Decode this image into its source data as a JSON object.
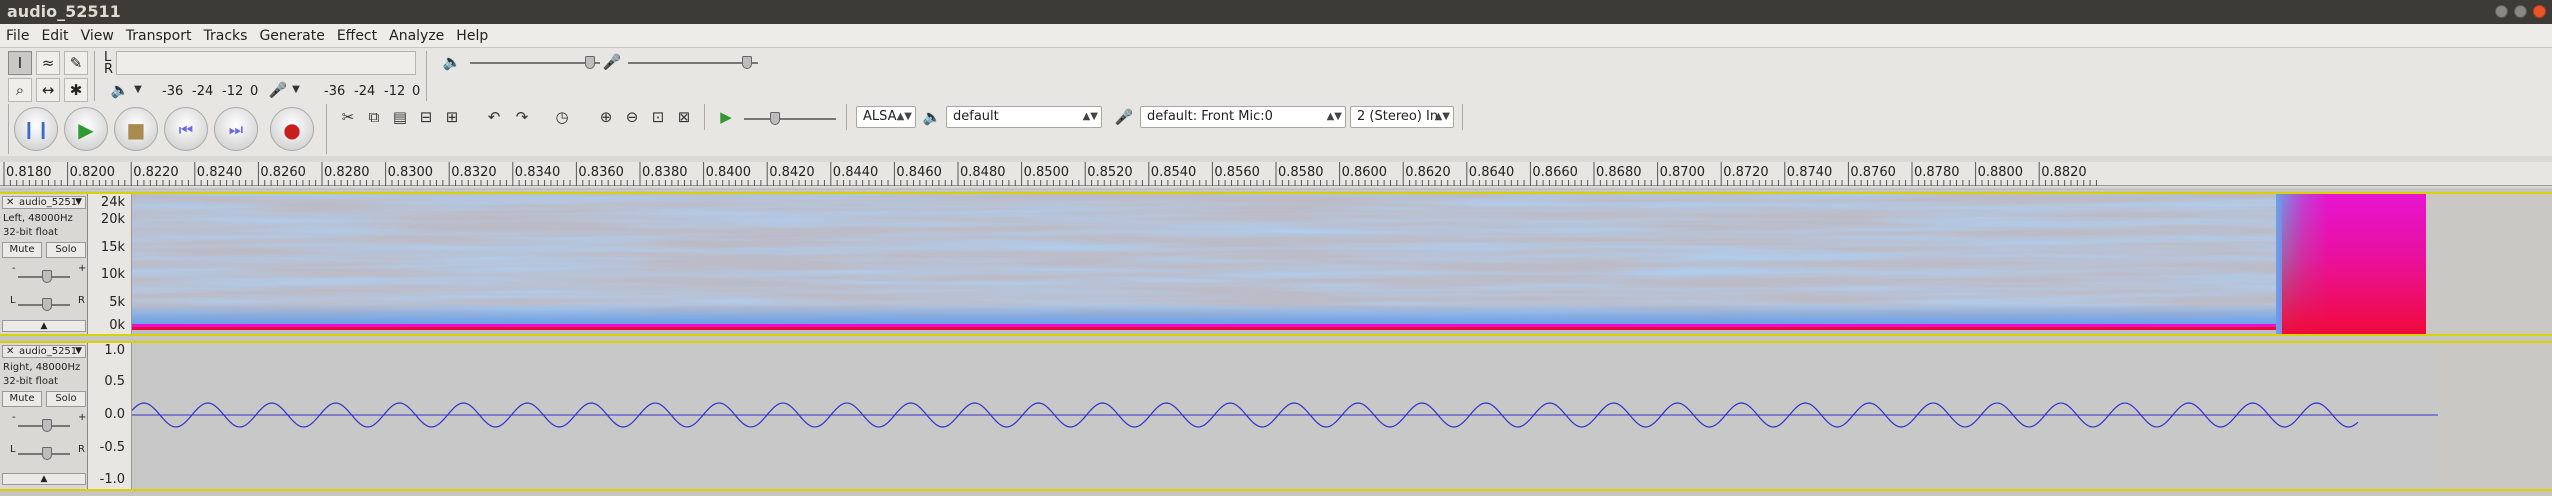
{
  "window": {
    "title": "audio_52511"
  },
  "menu": [
    "File",
    "Edit",
    "View",
    "Transport",
    "Tracks",
    "Generate",
    "Effect",
    "Analyze",
    "Help"
  ],
  "meters": {
    "lr_top": "L",
    "lr_bottom": "R",
    "rec_scale": [
      "-36",
      "-24",
      "-12",
      "0"
    ],
    "play_scale": [
      "-36",
      "-24",
      "-12",
      "0"
    ]
  },
  "device": {
    "host": "ALSA",
    "playback": "default",
    "recording": "default: Front Mic:0",
    "channels": "2 (Stereo) In"
  },
  "ruler": {
    "labels": [
      "0.8180",
      "0.8200",
      "0.8220",
      "0.8240",
      "0.8260",
      "0.8280",
      "0.8300",
      "0.8320",
      "0.8340",
      "0.8360",
      "0.8380",
      "0.8400",
      "0.8420",
      "0.8440",
      "0.8460",
      "0.8480",
      "0.8500",
      "0.8520",
      "0.8540",
      "0.8560",
      "0.8580",
      "0.8600",
      "0.8620",
      "0.8640",
      "0.8660",
      "0.8680",
      "0.8700",
      "0.8720",
      "0.8740",
      "0.8760",
      "0.8780",
      "0.8800",
      "0.8820"
    ]
  },
  "tracks": [
    {
      "name": "audio_5251",
      "channel_info": "Left, 48000Hz",
      "format": "32-bit float",
      "mute_label": "Mute",
      "solo_label": "Solo",
      "gain_minus": "-",
      "gain_plus": "+",
      "pan_left": "L",
      "pan_right": "R",
      "view": "spectrogram",
      "scale": [
        "24k",
        "20k",
        "15k",
        "10k",
        "5k",
        "0k"
      ]
    },
    {
      "name": "audio_5251",
      "channel_info": "Right, 48000Hz",
      "format": "32-bit float",
      "mute_label": "Mute",
      "solo_label": "Solo",
      "gain_minus": "-",
      "gain_plus": "+",
      "pan_left": "L",
      "pan_right": "R",
      "view": "waveform",
      "scale": [
        "1.0",
        "0.5",
        "0.0",
        "-0.5",
        "-1.0"
      ]
    }
  ],
  "colors": {
    "waveform": "#3232c8",
    "spectro_bg": "#bcbcc8",
    "spectro_blue": "#6aa0e8",
    "spectro_magenta": "#e614d2",
    "spectro_red": "#f00a3c"
  }
}
